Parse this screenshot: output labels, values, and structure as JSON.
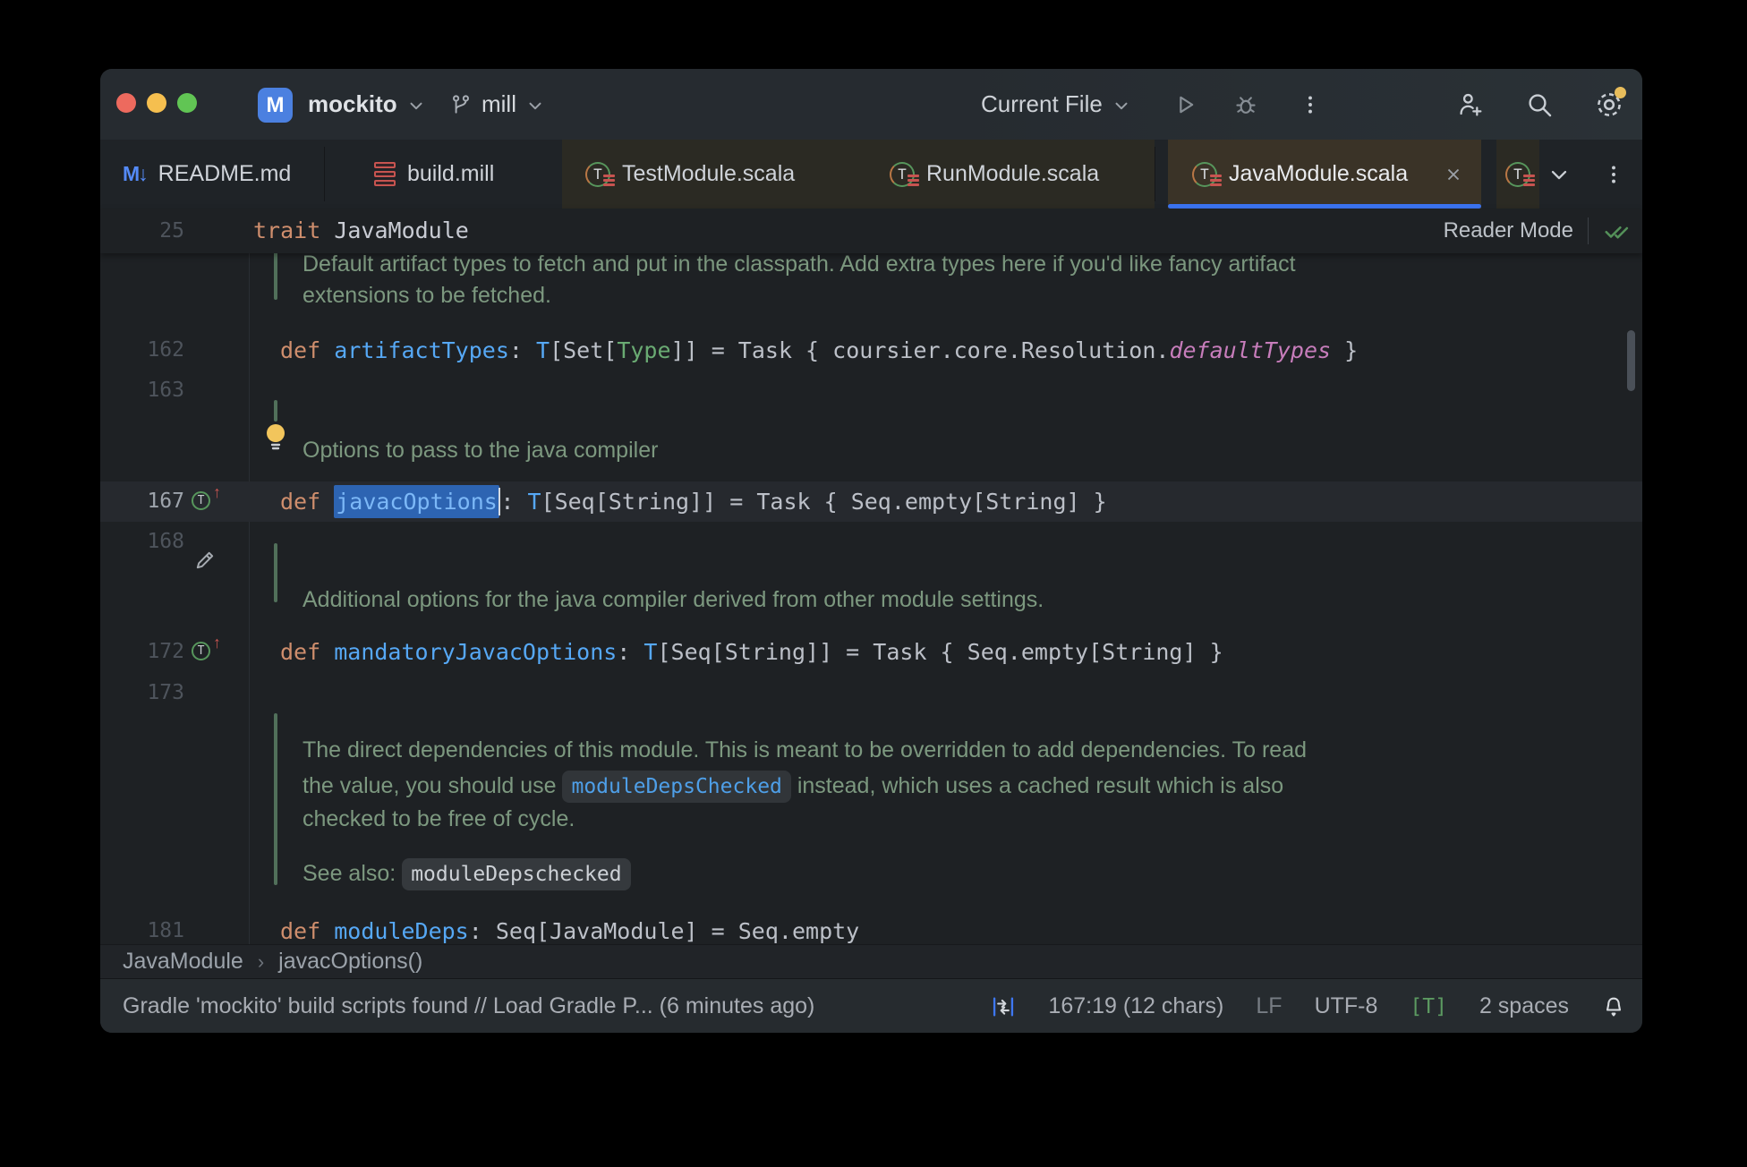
{
  "titlebar": {
    "project_icon": "M",
    "project": "mockito",
    "branch": "mill",
    "run_config": "Current File"
  },
  "tabs": {
    "items": [
      {
        "label": "README.md"
      },
      {
        "label": "build.mill"
      },
      {
        "label": "TestModule.scala"
      },
      {
        "label": "RunModule.scala"
      },
      {
        "label": "JavaModule.scala"
      }
    ]
  },
  "icons": {
    "trait_letter": "T",
    "override_arrow": "↑",
    "markdown_glyph": "M↓"
  },
  "sticky": {
    "line": "25",
    "keyword": "trait ",
    "name": "JavaModule",
    "reader_mode": "Reader Mode"
  },
  "doc": {
    "line1": "Default artifact types to fetch and put in the classpath. Add extra types here if you'd like fancy artifact",
    "line2": "extensions to be fetched.",
    "options": "Options to pass to the java compiler",
    "additional": "Additional options for the java compiler derived from other module settings.",
    "para1": "The direct dependencies of this module. This is meant to be overridden to add dependencies. To read",
    "para2_pre": "the value, you should use ",
    "para2_chip": "moduleDepsChecked",
    "para2_post": " instead, which uses a cached result which is also",
    "para3": "checked to be free of cycle.",
    "see_label": "See also: ",
    "see_chip": "moduleDepschecked"
  },
  "code": {
    "l162": {
      "num": "162",
      "kw": "def ",
      "name": "artifactTypes",
      "colon": ": ",
      "t": "T",
      "open": "[Set[",
      "type": "Type",
      "rest": "]] = Task { coursier.core.Resolution.",
      "italic": "defaultTypes",
      "end": " }"
    },
    "l163": {
      "num": "163"
    },
    "l167": {
      "num": "167",
      "kw": "def ",
      "name": "javacOptions",
      "colon": ": ",
      "t": "T",
      "rest": "[Seq[String]] = Task { Seq.empty[String] }"
    },
    "l168": {
      "num": "168"
    },
    "l172": {
      "num": "172",
      "kw": "def ",
      "name": "mandatoryJavacOptions",
      "colon": ": ",
      "t": "T",
      "rest": "[Seq[String]] = Task { Seq.empty[String] }"
    },
    "l173": {
      "num": "173"
    },
    "l181": {
      "num": "181",
      "kw": "def ",
      "name": "moduleDeps",
      "rest": ": Seq[JavaModule] = Seq.empty"
    }
  },
  "breadcrumb": {
    "items": [
      "JavaModule",
      "javacOptions()"
    ],
    "separator": "›"
  },
  "statusbar": {
    "message": "Gradle 'mockito' build scripts found // Load Gradle P... (6 minutes ago)",
    "position": "167:19 (12 chars)",
    "line_ending": "LF",
    "encoding": "UTF-8",
    "indicator": "[T]",
    "indent": "2 spaces"
  }
}
